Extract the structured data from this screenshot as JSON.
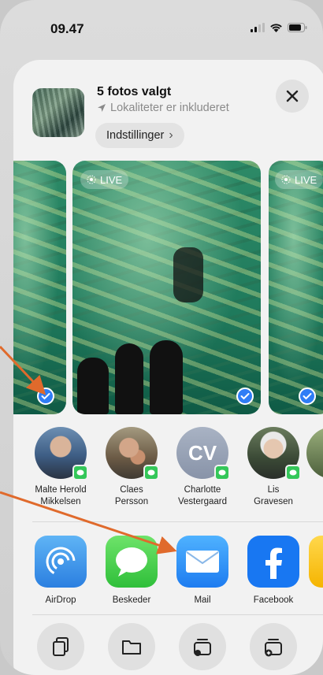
{
  "status_bar": {
    "time": "09.47"
  },
  "share_sheet": {
    "title": "5 fotos valgt",
    "subtitle": "Lokaliteter er inkluderet",
    "settings_label": "Indstillinger",
    "settings_chevron": "›"
  },
  "photos": {
    "live_label": "LIVE"
  },
  "contacts": [
    {
      "name_line1": "Malte Herold",
      "name_line2": "Mikkelsen"
    },
    {
      "name_line1": "Claes",
      "name_line2": "Persson"
    },
    {
      "name_line1": "Charlotte",
      "name_line2": "Vestergaard",
      "initials": "CV"
    },
    {
      "name_line1": "Lis",
      "name_line2": "Gravesen"
    }
  ],
  "apps": [
    {
      "label": "AirDrop"
    },
    {
      "label": "Beskeder"
    },
    {
      "label": "Mail"
    },
    {
      "label": "Facebook"
    }
  ],
  "colors": {
    "accent_blue": "#2f7df6",
    "messages_green": "#34c759",
    "annotation_arrow": "#e06a2c",
    "facebook_blue": "#1877f2"
  }
}
